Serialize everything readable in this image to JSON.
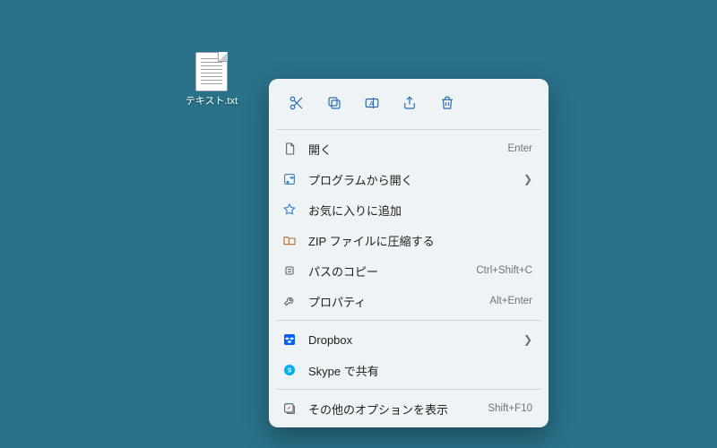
{
  "desktop": {
    "file_label": "テキスト.txt"
  },
  "topbar": {
    "cut": "cut",
    "copy": "copy",
    "rename": "rename",
    "share": "share",
    "delete": "delete"
  },
  "menu": {
    "open": {
      "label": "開く",
      "accel": "Enter"
    },
    "openwith": {
      "label": "プログラムから開く"
    },
    "favorite": {
      "label": "お気に入りに追加"
    },
    "zip": {
      "label": "ZIP ファイルに圧縮する"
    },
    "copypath": {
      "label": "パスのコピー",
      "accel": "Ctrl+Shift+C"
    },
    "properties": {
      "label": "プロパティ",
      "accel": "Alt+Enter"
    },
    "dropbox": {
      "label": "Dropbox"
    },
    "skype": {
      "label": "Skype で共有"
    },
    "moreoptions": {
      "label": "その他のオプションを表示",
      "accel": "Shift+F10"
    }
  }
}
